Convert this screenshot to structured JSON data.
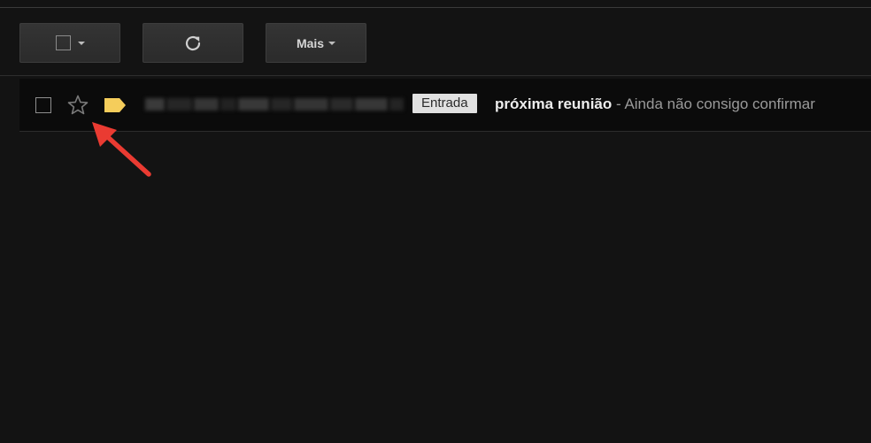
{
  "toolbar": {
    "more_label": "Mais"
  },
  "messages": [
    {
      "label": "Entrada",
      "subject": "próxima reunião",
      "separator": " - ",
      "snippet": "Ainda não consigo confirmar",
      "starred": false
    }
  ],
  "colors": {
    "background": "#131313",
    "row_background": "#0b0b0b",
    "tag_color": "#f5cd5b",
    "annotation_arrow": "#ea3b32"
  },
  "icons": {
    "select": "checkbox-icon",
    "select_menu": "chevron-down-icon",
    "refresh": "refresh-icon",
    "more_menu": "chevron-down-icon",
    "star": "star-outline-icon",
    "label_tag": "label-tag-icon"
  }
}
